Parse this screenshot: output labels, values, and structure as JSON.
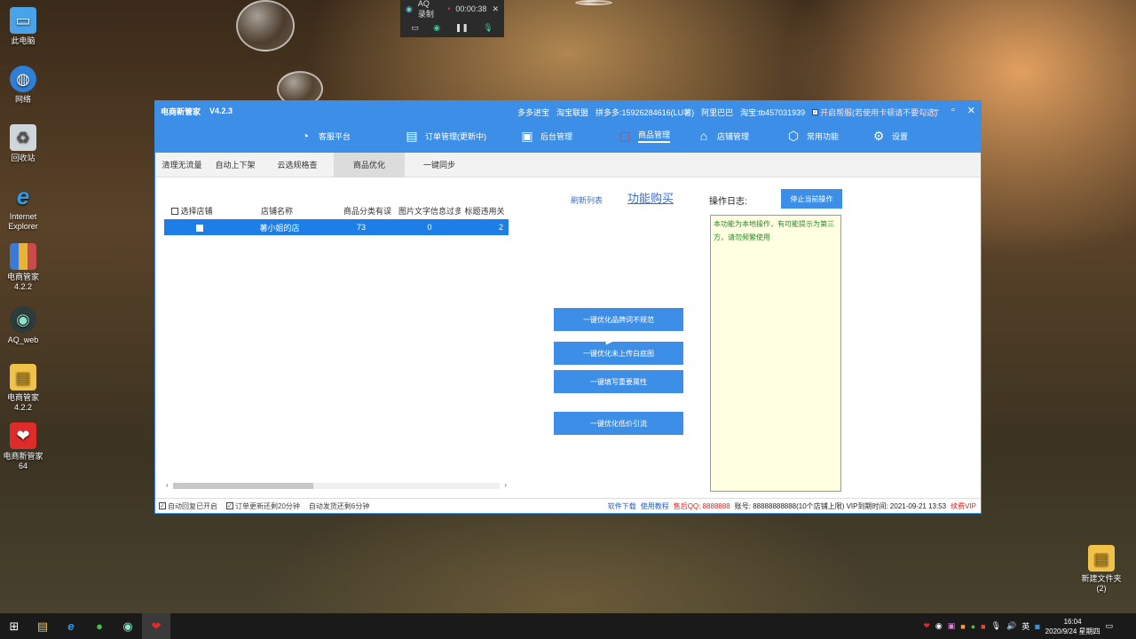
{
  "desktop": {
    "icons": [
      {
        "label": "此电脑"
      },
      {
        "label": "网络"
      },
      {
        "label": "回收站"
      },
      {
        "label": "Internet Explorer"
      },
      {
        "label": "电商管家 4.2.2"
      },
      {
        "label": "AQ_web"
      },
      {
        "label": "电商管家 4.2.2"
      },
      {
        "label": "电商新管家 64"
      }
    ],
    "right_icon": {
      "label": "新建文件夹 (2)"
    }
  },
  "recorder": {
    "title": "AQ录制",
    "time": "00:00:38"
  },
  "app": {
    "title": "电商新管家",
    "version": "V4.2.3",
    "titlebar_info": [
      "多多进宝",
      "淘宝联盟",
      "拼多多:15926284616(LU薯)",
      "阿里巴巴",
      "淘宝:tb457031939",
      "开启帮服(若使用卡顿请不要勾选)"
    ],
    "nav": [
      {
        "label": "客服平台",
        "icon": "headset-icon"
      },
      {
        "label": "订单管理(更新中)",
        "icon": "clipboard-icon"
      },
      {
        "label": "后台管理",
        "icon": "monitor-chart-icon"
      },
      {
        "label": "商品管理",
        "icon": "goods-icon"
      },
      {
        "label": "店铺管理",
        "icon": "store-icon"
      },
      {
        "label": "常用功能",
        "icon": "cube-icon"
      },
      {
        "label": "设置",
        "icon": "gear-icon"
      }
    ],
    "tabs": [
      {
        "label": "清理无流量"
      },
      {
        "label": "自动上下架"
      },
      {
        "label": "云选规格查"
      },
      {
        "label": "商品优化"
      },
      {
        "label": "一键同步"
      }
    ],
    "grid": {
      "headers": [
        "选择店铺",
        "店铺名称",
        "商品分类有误",
        "图片文字信息过多",
        "标题违用关"
      ],
      "rows": [
        {
          "shop": "薯小姐的店",
          "cat_err": "73",
          "img_txt": "0",
          "title_err": "2"
        }
      ]
    },
    "links": {
      "refresh": "刷新列表",
      "buy": "功能购买"
    },
    "actions": [
      "一键优化品牌词不规范",
      "一键优化未上传白底图",
      "一键填写重要属性",
      "一键优化低价引流"
    ],
    "log": {
      "label": "操作日志:",
      "stop_button": "停止当前操作",
      "text": "本功能为本地操作，有可能提示为第三方，请勿频繁使用"
    },
    "status": {
      "left": [
        "自动回复已开启",
        "订单更新还剩20分钟",
        "自动发货还剩6分钟"
      ],
      "download": "软件下载",
      "tutorial": "使用教程",
      "qq": "售后QQ: 8888888",
      "account": "账号: 88888888888(10个店铺上限) VIP到期时间: 2021-09-21 13:53",
      "renew": "续费VIP"
    }
  },
  "taskbar": {
    "tray_lang": "英",
    "time": "16:04",
    "date": "2020/9/24 星期四"
  },
  "colors": {
    "accent": "#3d8ee6",
    "selected_row": "#1e7ee8",
    "log_bg": "#ffffe1",
    "log_text": "#2a8a2a"
  }
}
